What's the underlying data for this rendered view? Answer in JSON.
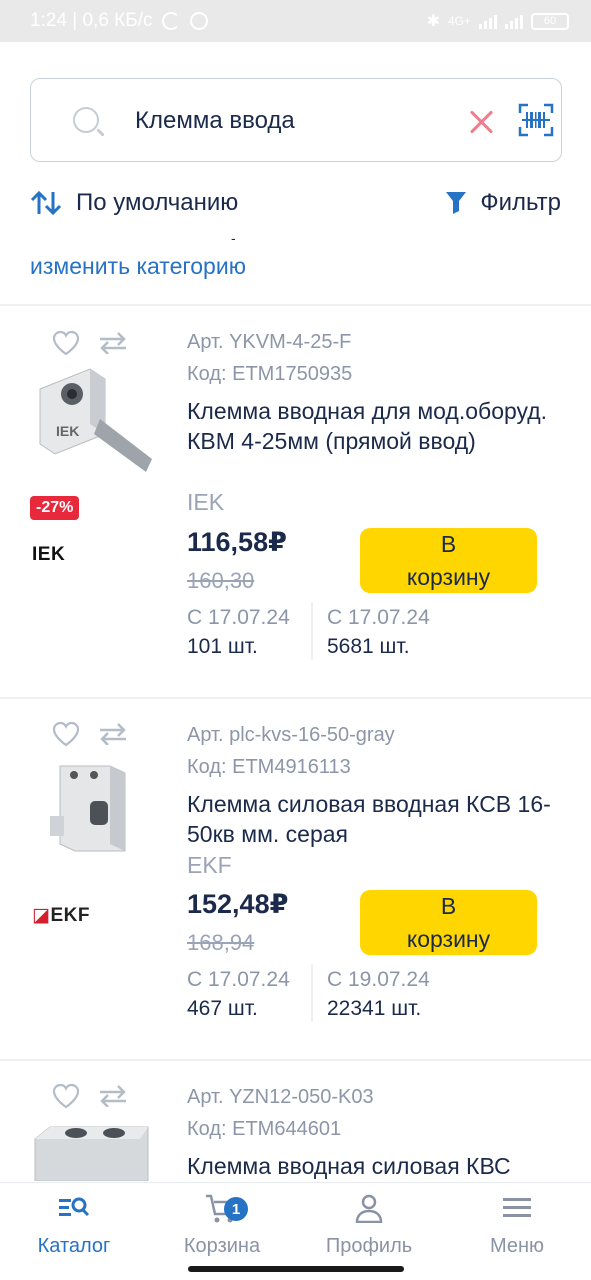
{
  "status_bar": {
    "time_info": "1:24 | 0,6 КБ/с",
    "battery": "60",
    "network_label": "4G+"
  },
  "search": {
    "query": "Клемма ввода",
    "placeholder": ""
  },
  "toolbar": {
    "sort_label": "По умолчанию",
    "filter_label": "Фильтр"
  },
  "category": {
    "separator": "-",
    "change_label": "изменить категорию"
  },
  "products": [
    {
      "article": "Арт. YKVM-4-25-F",
      "code": "Код: ETM1750935",
      "title": "Клемма вводная для мод.оборуд. КВМ 4-25мм (прямой ввод)",
      "brand": "IEK",
      "brand_logo": "IEK",
      "discount": "-27%",
      "price": "116,58₽",
      "old_price": "160,30",
      "cart_label": "В корзину",
      "stock": [
        {
          "date": "С 17.07.24",
          "qty": "101 шт."
        },
        {
          "date": "С 17.07.24",
          "qty": "5681 шт."
        }
      ]
    },
    {
      "article": "Арт. plc-kvs-16-50-gray",
      "code": "Код: ETM4916113",
      "title": "Клемма силовая вводная КСВ 16-50кв мм. серая",
      "brand": "EKF",
      "brand_logo": "EKF",
      "discount": "",
      "price": "152,48₽",
      "old_price": "168,94",
      "cart_label": "В корзину",
      "stock": [
        {
          "date": "С 17.07.24",
          "qty": "467 шт."
        },
        {
          "date": "С 19.07.24",
          "qty": "22341 шт."
        }
      ]
    },
    {
      "article": "Арт. YZN12-050-K03",
      "code": "Код: ETM644601",
      "title": "Клемма вводная силовая КВС"
    }
  ],
  "bottom_nav": [
    {
      "label": "Каталог",
      "icon": "catalog-search-icon",
      "active": true
    },
    {
      "label": "Корзина",
      "icon": "cart-icon",
      "badge": "1"
    },
    {
      "label": "Профиль",
      "icon": "profile-icon"
    },
    {
      "label": "Меню",
      "icon": "menu-icon"
    }
  ],
  "colors": {
    "accent": "#2672c5",
    "cart_button": "#ffd600",
    "discount": "#e8293c",
    "text_primary": "#1b2a4a",
    "text_muted": "#8c96a8"
  }
}
